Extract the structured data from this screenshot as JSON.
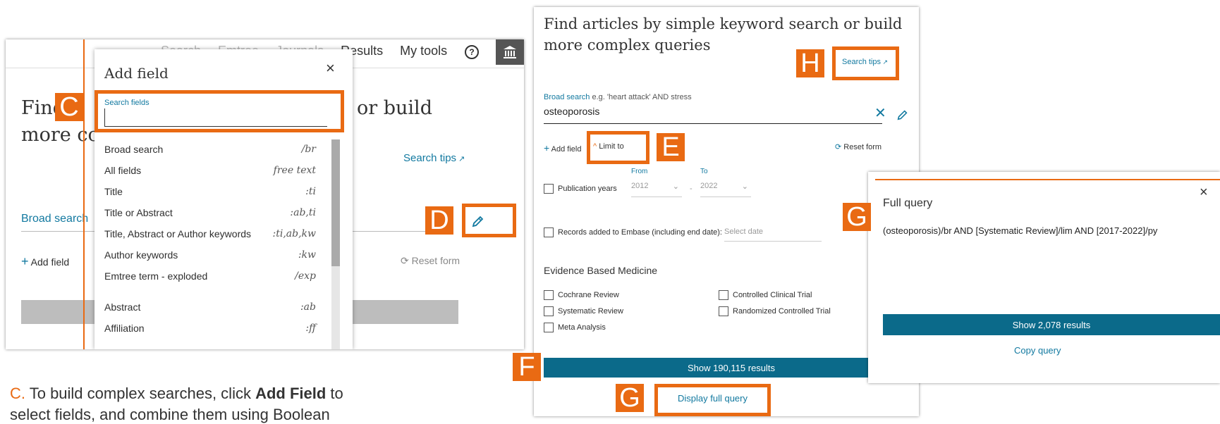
{
  "left_panel": {
    "nav": [
      "Search",
      "Emtree",
      "Journals",
      "Results",
      "My tools"
    ],
    "help_icon": "help-circle-icon",
    "institution_icon": "bank-icon",
    "heading_line1": "Find",
    "heading_line1_end": "or build",
    "heading_line2": "more co",
    "search_tips": "Search tips",
    "broad_search": "Broad search",
    "add_field": "Add field",
    "reset_form": "Reset form"
  },
  "add_field_dropdown": {
    "title": "Add field",
    "close": "×",
    "search_label": "Search fields",
    "search_value": "",
    "fields": [
      {
        "name": "Broad search",
        "code": "/br"
      },
      {
        "name": "All fields",
        "code": "free text"
      },
      {
        "name": "Title",
        "code": ":ti"
      },
      {
        "name": "Title or Abstract",
        "code": ":ab,ti"
      },
      {
        "name": "Title, Abstract or Author keywords",
        "code": ":ti,ab,kw"
      },
      {
        "name": "Author keywords",
        "code": ":kw"
      },
      {
        "name": "Emtree term - exploded",
        "code": "/exp"
      },
      {
        "name": "Abstract",
        "code": ":ab"
      },
      {
        "name": "Affiliation",
        "code": ":ff"
      }
    ]
  },
  "middle_panel": {
    "heading_line1": "Find articles by simple keyword search or build",
    "heading_line2": "more complex queries",
    "search_tips": "Search tips",
    "broad_search_label": "Broad search",
    "broad_search_example": "e.g. 'heart attack' AND stress",
    "query_value": "osteoporosis",
    "add_field": "Add field",
    "limit_to": "Limit to",
    "reset_form": "Reset form",
    "from_label": "From",
    "to_label": "To",
    "publication_years": "Publication years",
    "from_year": "2012",
    "to_year": "2022",
    "dash": "-",
    "records_added": "Records added to Embase (including end date):",
    "select_date": "Select date",
    "ebm_heading": "Evidence Based Medicine",
    "ebm_left": [
      "Cochrane Review",
      "Systematic Review",
      "Meta Analysis"
    ],
    "ebm_right": [
      "Controlled Clinical Trial",
      "Randomized Controlled Trial"
    ],
    "show_results": "Show 190,115 results",
    "display_full_query": "Display full query"
  },
  "right_panel": {
    "close": "×",
    "title": "Full query",
    "query": "(osteoporosis)/br AND [Systematic Review]/lim AND [2017-2022]/py",
    "show_results": "Show 2,078 results",
    "copy_query": "Copy query"
  },
  "badges": {
    "c": "C",
    "d": "D",
    "e": "E",
    "f": "F",
    "g1": "G",
    "g2": "G",
    "h": "H"
  },
  "caption": {
    "letter": "C.",
    "text1": " To build complex searches, click ",
    "bold": "Add Field",
    "text2": " to",
    "line2": "select fields, and combine them using Boolean"
  },
  "colors": {
    "orange": "#e96a13",
    "teal": "#0b6a8a",
    "link": "#1279a0"
  }
}
